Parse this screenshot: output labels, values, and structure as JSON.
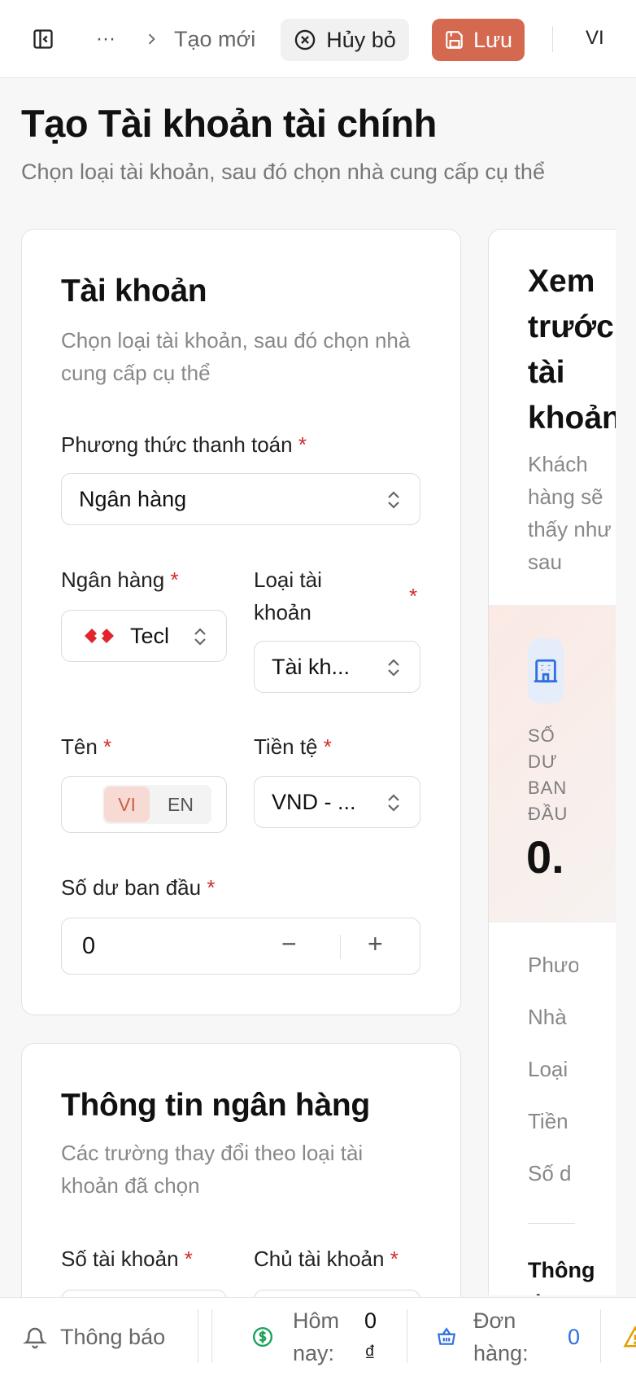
{
  "topbar": {
    "more_label": "···",
    "breadcrumb_current": "Tạo mới",
    "cancel_label": "Hủy bỏ",
    "save_label": "Lưu",
    "language": "VI"
  },
  "header": {
    "title": "Tạo Tài khoản tài chính",
    "subtitle": "Chọn loại tài khoản, sau đó chọn nhà cung cấp cụ thể"
  },
  "account_card": {
    "title": "Tài khoản",
    "description": "Chọn loại tài khoản, sau đó chọn nhà cung cấp cụ thể",
    "payment_method": {
      "label": "Phương thức thanh toán",
      "value": "Ngân hàng"
    },
    "bank": {
      "label": "Ngân hàng",
      "value": "Tecl"
    },
    "account_type": {
      "label": "Loại tài khoản",
      "value": "Tài kh..."
    },
    "name": {
      "label": "Tên",
      "lang_vi": "VI",
      "lang_en": "EN"
    },
    "currency": {
      "label": "Tiền tệ",
      "value": "VND - ..."
    },
    "opening_balance": {
      "label": "Số dư ban đầu",
      "value": "0",
      "minus": "−",
      "plus": "+"
    }
  },
  "bank_info_card": {
    "title": "Thông tin ngân hàng",
    "description": "Các trường thay đổi theo loại tài khoản đã chọn",
    "account_number_label": "Số tài khoản",
    "account_holder_label": "Chủ tài khoản"
  },
  "preview_card": {
    "title": "Xem trước tài khoản",
    "description": "Khách hàng sẽ thấy như sau",
    "balance_label": "SỐ DƯ BAN ĐẦU",
    "balance_value": "0.",
    "rows": [
      "Phươ",
      "Nhà",
      "Loại",
      "Tiền",
      "Số d"
    ],
    "section_title": "Thông tin"
  },
  "statusbar": {
    "notifications_label": "Thông báo",
    "today_label": "Hôm nay:",
    "today_value": "0 ₫",
    "orders_label": "Đơn hàng:",
    "orders_value": "0"
  },
  "colors": {
    "accent": "#d4694f",
    "required": "#d12c2c",
    "money_green": "#1aa35a",
    "link_blue": "#2f6fe0"
  }
}
